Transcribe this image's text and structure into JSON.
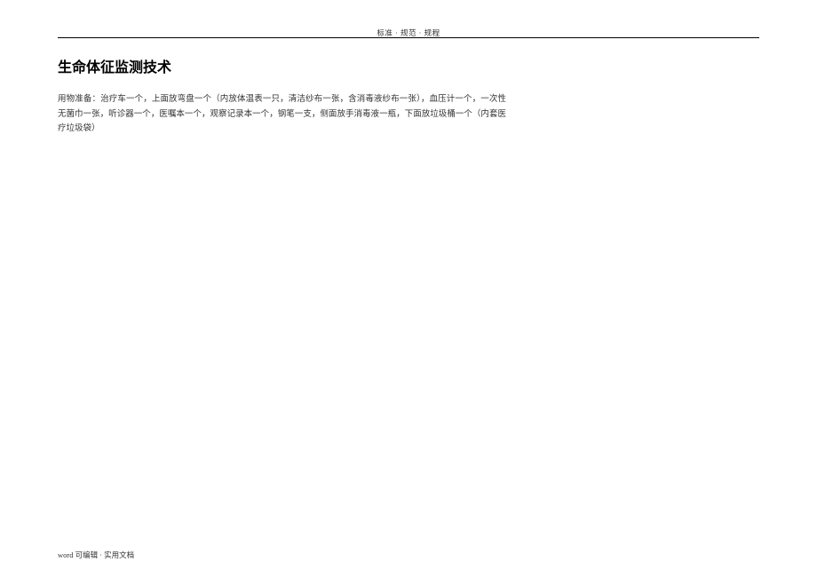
{
  "header": {
    "text": "标准 · 规范 · 规程"
  },
  "document": {
    "title": "生命体征监测技术",
    "body": "用物准备：治疗车一个，上面放弯盘一个（内放体温表一只，清洁纱布一张，含消毒液纱布一张），血压计一个，一次性无菌巾一张，听诊器一个，医嘱本一个，观察记录本一个，钢笔一支，侧面放手消毒液一瓶，下面放垃圾桶一个（内套医疗垃圾袋）"
  },
  "footer": {
    "text": "word 可编辑 · 实用文档"
  }
}
